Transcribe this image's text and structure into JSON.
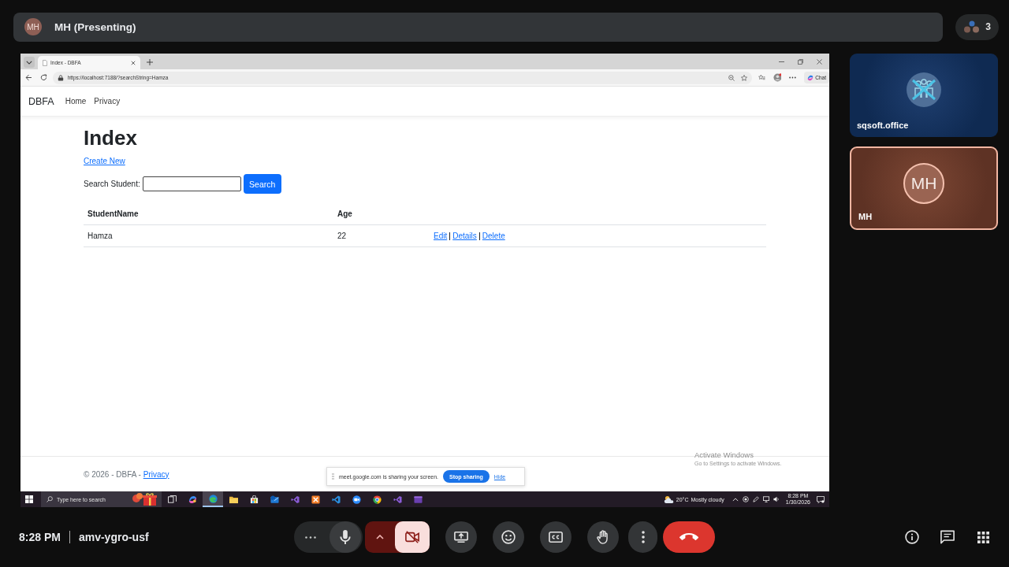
{
  "top_bar": {
    "presenter": {
      "initials": "MH",
      "label": "MH (Presenting)"
    },
    "participant_count": "3"
  },
  "browser": {
    "tabs": [
      {
        "title": "Index - DBFA",
        "selected": true
      }
    ],
    "url": "https://localhost:7188/?searchString=Hamza",
    "chat_button": "Chat"
  },
  "page": {
    "navbar": {
      "brand": "DBFA",
      "links": [
        "Home",
        "Privacy"
      ]
    },
    "heading": "Index",
    "create_link": "Create New",
    "search": {
      "label": "Search Student:",
      "button": "Search"
    },
    "table": {
      "columns": [
        "StudentName",
        "Age"
      ],
      "rows": [
        {
          "cells": [
            "Hamza",
            "22"
          ],
          "actions": [
            "Edit",
            "Details",
            "Delete"
          ]
        }
      ]
    },
    "footer": {
      "text": "© 2026 - DBFA -",
      "link": "Privacy"
    }
  },
  "activation_notice": {
    "title": "Activate Windows",
    "hint": "Go to Settings to activate Windows."
  },
  "share_bar": {
    "message": "meet.google.com is sharing your screen.",
    "stop_button": "Stop sharing",
    "hide_link": "Hide"
  },
  "taskbar": {
    "search_placeholder": "Type here to search",
    "apps": [
      {
        "kind": "task-view",
        "selected": false
      },
      {
        "kind": "swirl",
        "selected": false
      },
      {
        "kind": "wave",
        "selected": true
      },
      {
        "kind": "folder",
        "selected": false
      },
      {
        "kind": "bag",
        "selected": false
      },
      {
        "kind": "mail",
        "selected": false
      },
      {
        "kind": "infinity",
        "selected": false
      },
      {
        "kind": "square-logo",
        "selected": false
      },
      {
        "kind": "ribbon",
        "selected": false
      },
      {
        "kind": "video",
        "selected": false
      },
      {
        "kind": "tricolor",
        "selected": false
      },
      {
        "kind": "infinity",
        "selected": false
      },
      {
        "kind": "window",
        "selected": false
      }
    ],
    "weather": {
      "temperature": "20°C",
      "condition": "Mostly cloudy"
    },
    "clock": {
      "time": "8:28 PM",
      "date": "1/30/2026"
    }
  },
  "tiles": [
    {
      "kind": "logo",
      "name": "sqsoft.office"
    },
    {
      "kind": "initials",
      "initials": "MH",
      "name": "MH"
    }
  ],
  "bottom_bar": {
    "time": "8:28 PM",
    "meeting_code": "amv-ygro-usf",
    "mic_on": true,
    "camera_on": false
  }
}
